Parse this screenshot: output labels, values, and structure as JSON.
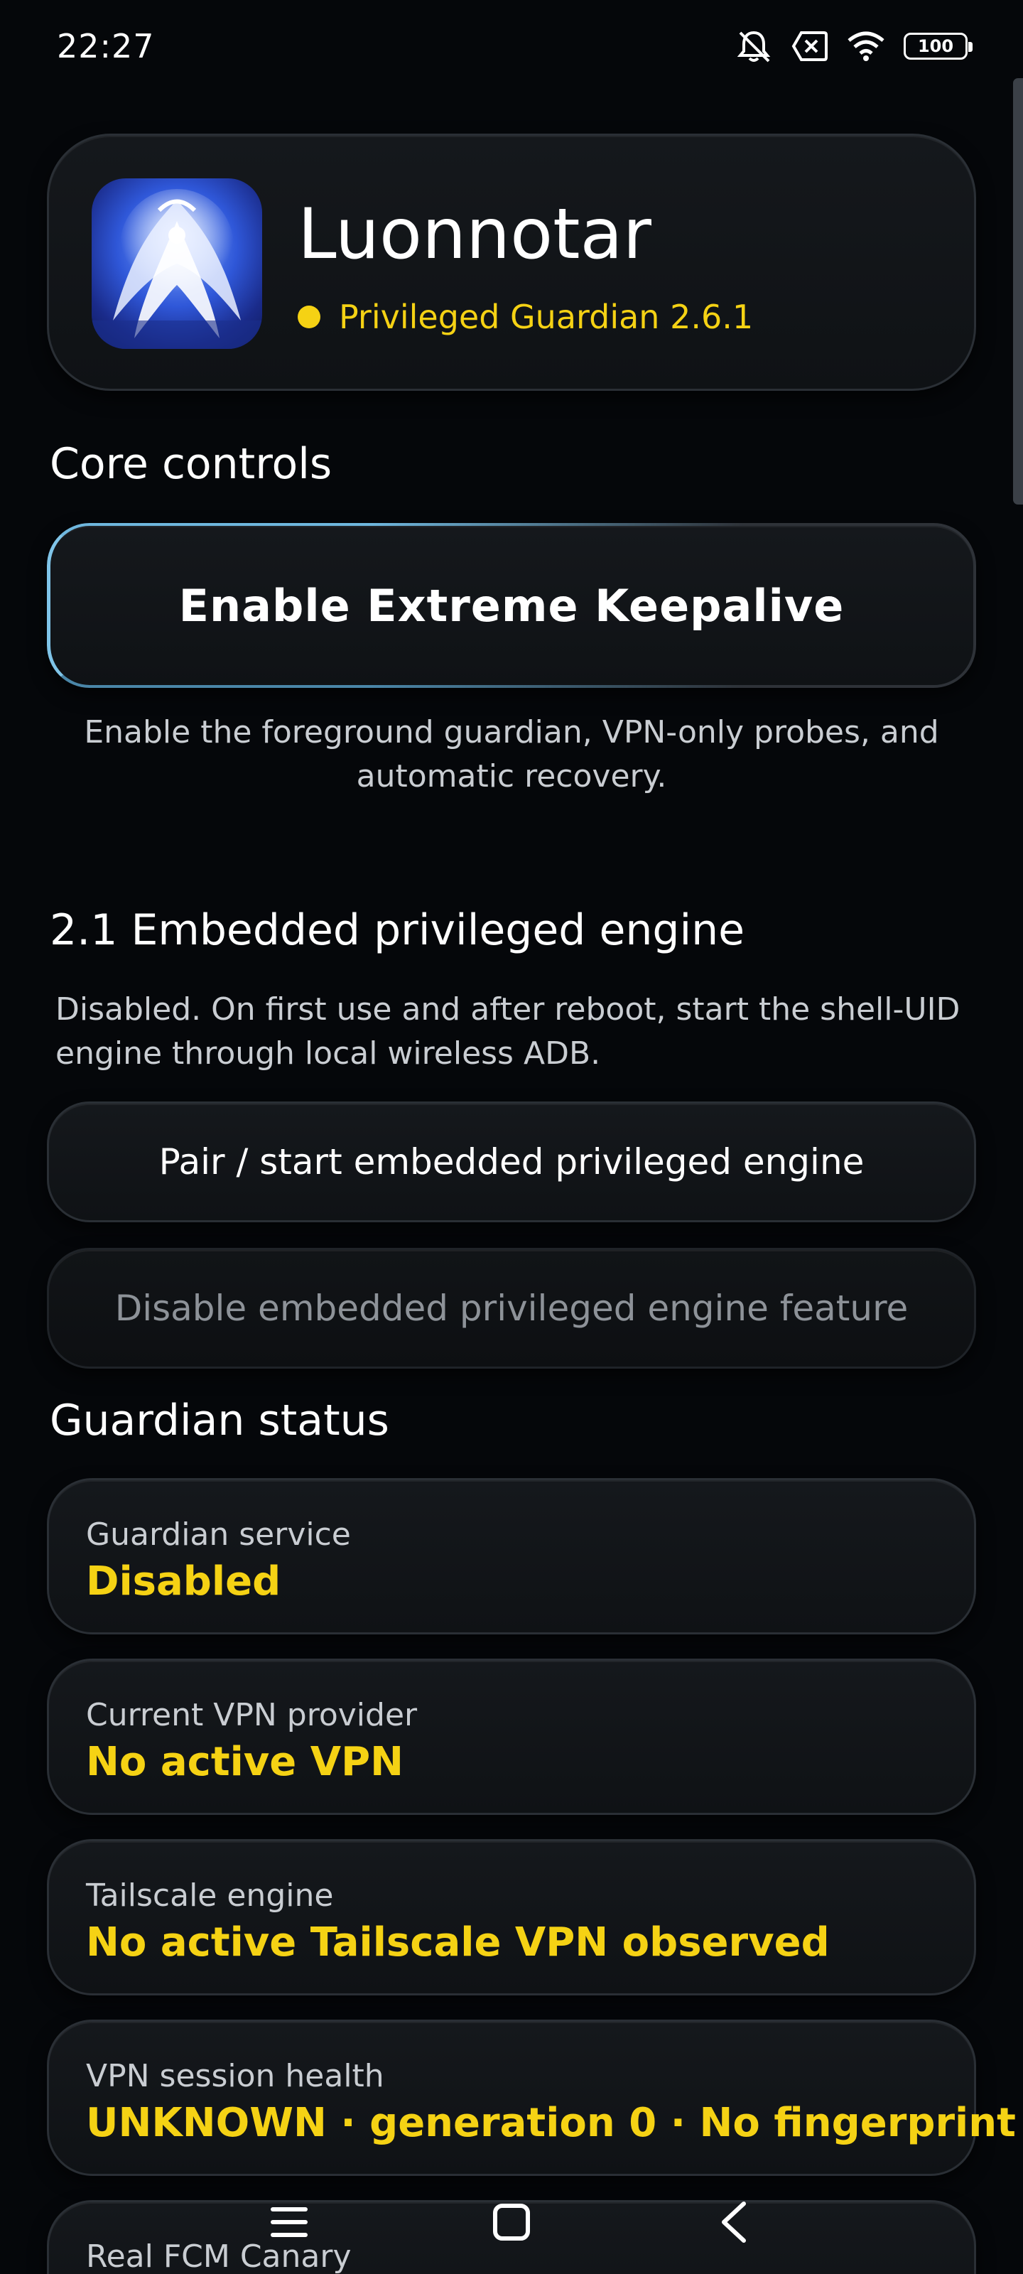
{
  "status_bar": {
    "time": "22:27",
    "battery": "100",
    "icons": [
      "bell-muted-icon",
      "sim-error-icon",
      "wifi-icon",
      "battery-icon"
    ]
  },
  "app": {
    "name": "Luonnotar",
    "version_label": "Privileged Guardian 2.6.1",
    "status_dot_color": "#f5d214"
  },
  "core_controls": {
    "title": "Core controls",
    "keepalive_button": "Enable Extreme Keepalive",
    "keepalive_caption": "Enable the foreground guardian, VPN-only probes, and automatic recovery."
  },
  "engine": {
    "title": "2.1 Embedded privileged engine",
    "description": "Disabled. On first use and after reboot, start the shell-UID engine through local wireless ADB.",
    "pair_button": "Pair / start embedded privileged engine",
    "disable_button": "Disable embedded privileged engine feature"
  },
  "guardian_status": {
    "title": "Guardian status",
    "cards": [
      {
        "label": "Guardian service",
        "value": "Disabled"
      },
      {
        "label": "Current VPN provider",
        "value": "No active VPN"
      },
      {
        "label": "Tailscale engine",
        "value": "No active Tailscale VPN observed"
      },
      {
        "label": "VPN session health",
        "value": "UNKNOWN · generation 0 · No fingerprint"
      },
      {
        "label": "Real FCM Canary",
        "value": ""
      }
    ]
  },
  "colors": {
    "accent_yellow": "#f5d214",
    "background": "#05070a",
    "highlight_border": "#7fc4e8"
  },
  "nav": {
    "items": [
      "menu-icon",
      "home-icon",
      "back-icon"
    ]
  }
}
